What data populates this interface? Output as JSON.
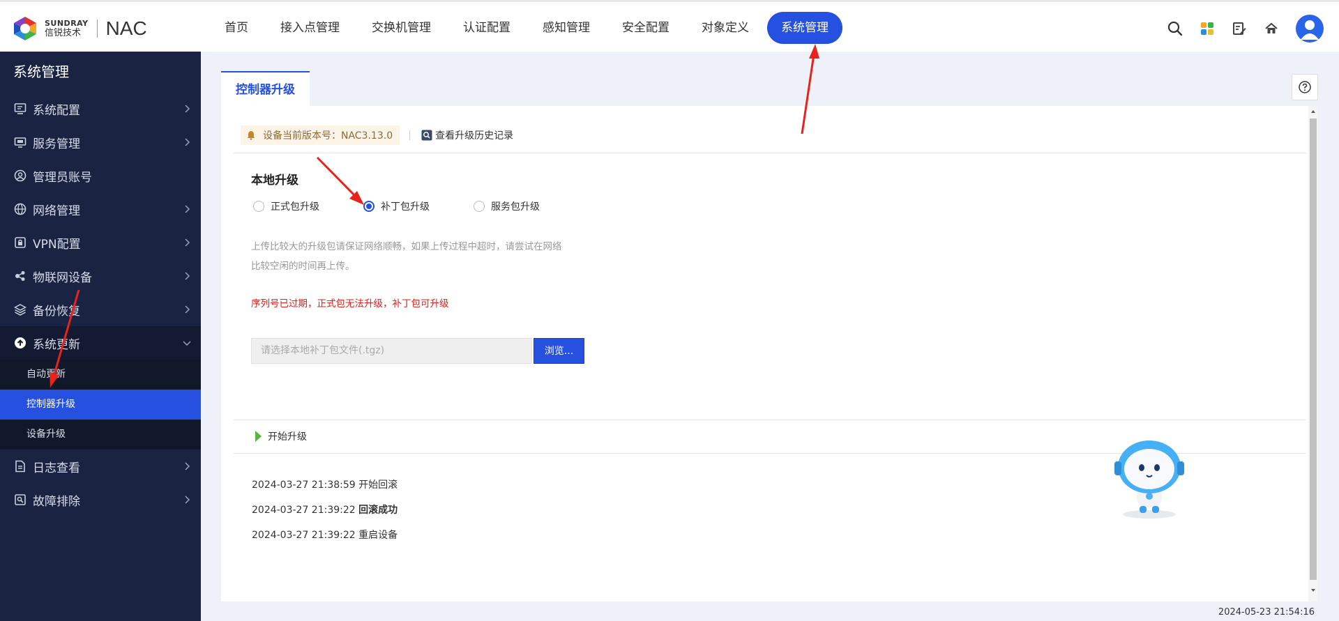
{
  "brand": {
    "company_en": "SUNDRAY",
    "company_cn": "信锐技术",
    "product": "NAC"
  },
  "nav": {
    "items": [
      {
        "label": "首页",
        "active": false
      },
      {
        "label": "接入点管理",
        "active": false
      },
      {
        "label": "交换机管理",
        "active": false
      },
      {
        "label": "认证配置",
        "active": false
      },
      {
        "label": "感知管理",
        "active": false
      },
      {
        "label": "安全配置",
        "active": false
      },
      {
        "label": "对象定义",
        "active": false
      },
      {
        "label": "系统管理",
        "active": true
      }
    ]
  },
  "top_icons": [
    "search-icon",
    "apps-icon",
    "edit-icon",
    "home-icon",
    "user-avatar"
  ],
  "sidebar": {
    "title": "系统管理",
    "items": [
      {
        "label": "系统配置",
        "icon": "monitor-icon",
        "has_children": true
      },
      {
        "label": "服务管理",
        "icon": "service-icon",
        "has_children": true
      },
      {
        "label": "管理员账号",
        "icon": "user-icon",
        "has_children": false
      },
      {
        "label": "网络管理",
        "icon": "globe-icon",
        "has_children": true
      },
      {
        "label": "VPN配置",
        "icon": "lock-icon",
        "has_children": true
      },
      {
        "label": "物联网设备",
        "icon": "iot-icon",
        "has_children": true
      },
      {
        "label": "备份恢复",
        "icon": "layers-icon",
        "has_children": true
      },
      {
        "label": "系统更新",
        "icon": "upload-icon",
        "has_children": true,
        "open": true
      },
      {
        "label": "日志查看",
        "icon": "doc-icon",
        "has_children": true
      },
      {
        "label": "故障排除",
        "icon": "wrench-icon",
        "has_children": true
      }
    ],
    "sub_items": [
      {
        "label": "自动更新",
        "active": false
      },
      {
        "label": "控制器升级",
        "active": true
      },
      {
        "label": "设备升级",
        "active": false
      }
    ]
  },
  "tab": {
    "label": "控制器升级"
  },
  "version_bar": {
    "version_label": "设备当前版本号：NAC3.13.0",
    "history_label": "查看升级历史记录"
  },
  "local_upgrade": {
    "title": "本地升级",
    "options": [
      {
        "label": "正式包升级",
        "checked": false
      },
      {
        "label": "补丁包升级",
        "checked": true
      },
      {
        "label": "服务包升级",
        "checked": false
      }
    ],
    "tip_line1": "上传比较大的升级包请保证网络顺畅，如果上传过程中超时，请尝试在网络",
    "tip_line2": "比较空闲的时间再上传。",
    "warning": "序列号已过期，正式包无法升级，补丁包可升级",
    "file_placeholder": "请选择本地补丁包文件(.tgz)",
    "browse_label": "浏览..."
  },
  "start": {
    "label": "开始升级"
  },
  "logs": [
    {
      "time": "2024-03-27 21:38:59",
      "message": "开始回滚",
      "bold": false
    },
    {
      "time": "2024-03-27 21:39:22",
      "message": "回滚成功",
      "bold": true
    },
    {
      "time": "2024-03-27 21:39:22",
      "message": "重启设备",
      "bold": false
    }
  ],
  "footer": {
    "timestamp": "2024-05-23 21:54:16"
  },
  "colors": {
    "accent": "#2550e0",
    "sidebar_bg": "#1a2442",
    "warning": "#e0201c",
    "annotation": "#e8231d"
  }
}
